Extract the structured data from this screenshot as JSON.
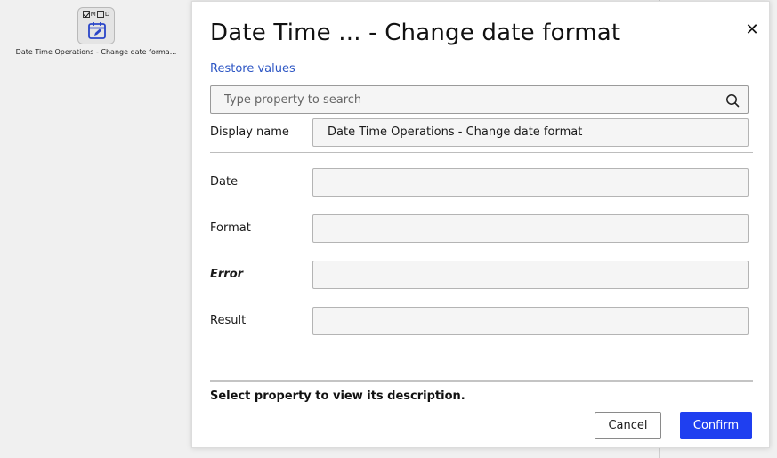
{
  "canvas": {
    "activity_label": "Date Time Operations - Change date forma...",
    "activity_icon_letters": [
      "M",
      "D"
    ]
  },
  "dialog": {
    "title": "Date Time ... - Change date format",
    "restore_label": "Restore values",
    "search": {
      "placeholder": "Type property to search",
      "value": ""
    },
    "display_name": {
      "label": "Display name",
      "value": "Date Time Operations - Change date format"
    },
    "properties": [
      {
        "label": "Date",
        "value": ""
      },
      {
        "label": "Format",
        "value": ""
      },
      {
        "label": "Error",
        "value": ""
      },
      {
        "label": "Result",
        "value": ""
      }
    ],
    "description": "Select property to view its description.",
    "cancel_label": "Cancel",
    "confirm_label": "Confirm"
  },
  "colors": {
    "accent": "#1f3ff0",
    "link": "#2d56c4",
    "icon_blue": "#2a45c8"
  }
}
